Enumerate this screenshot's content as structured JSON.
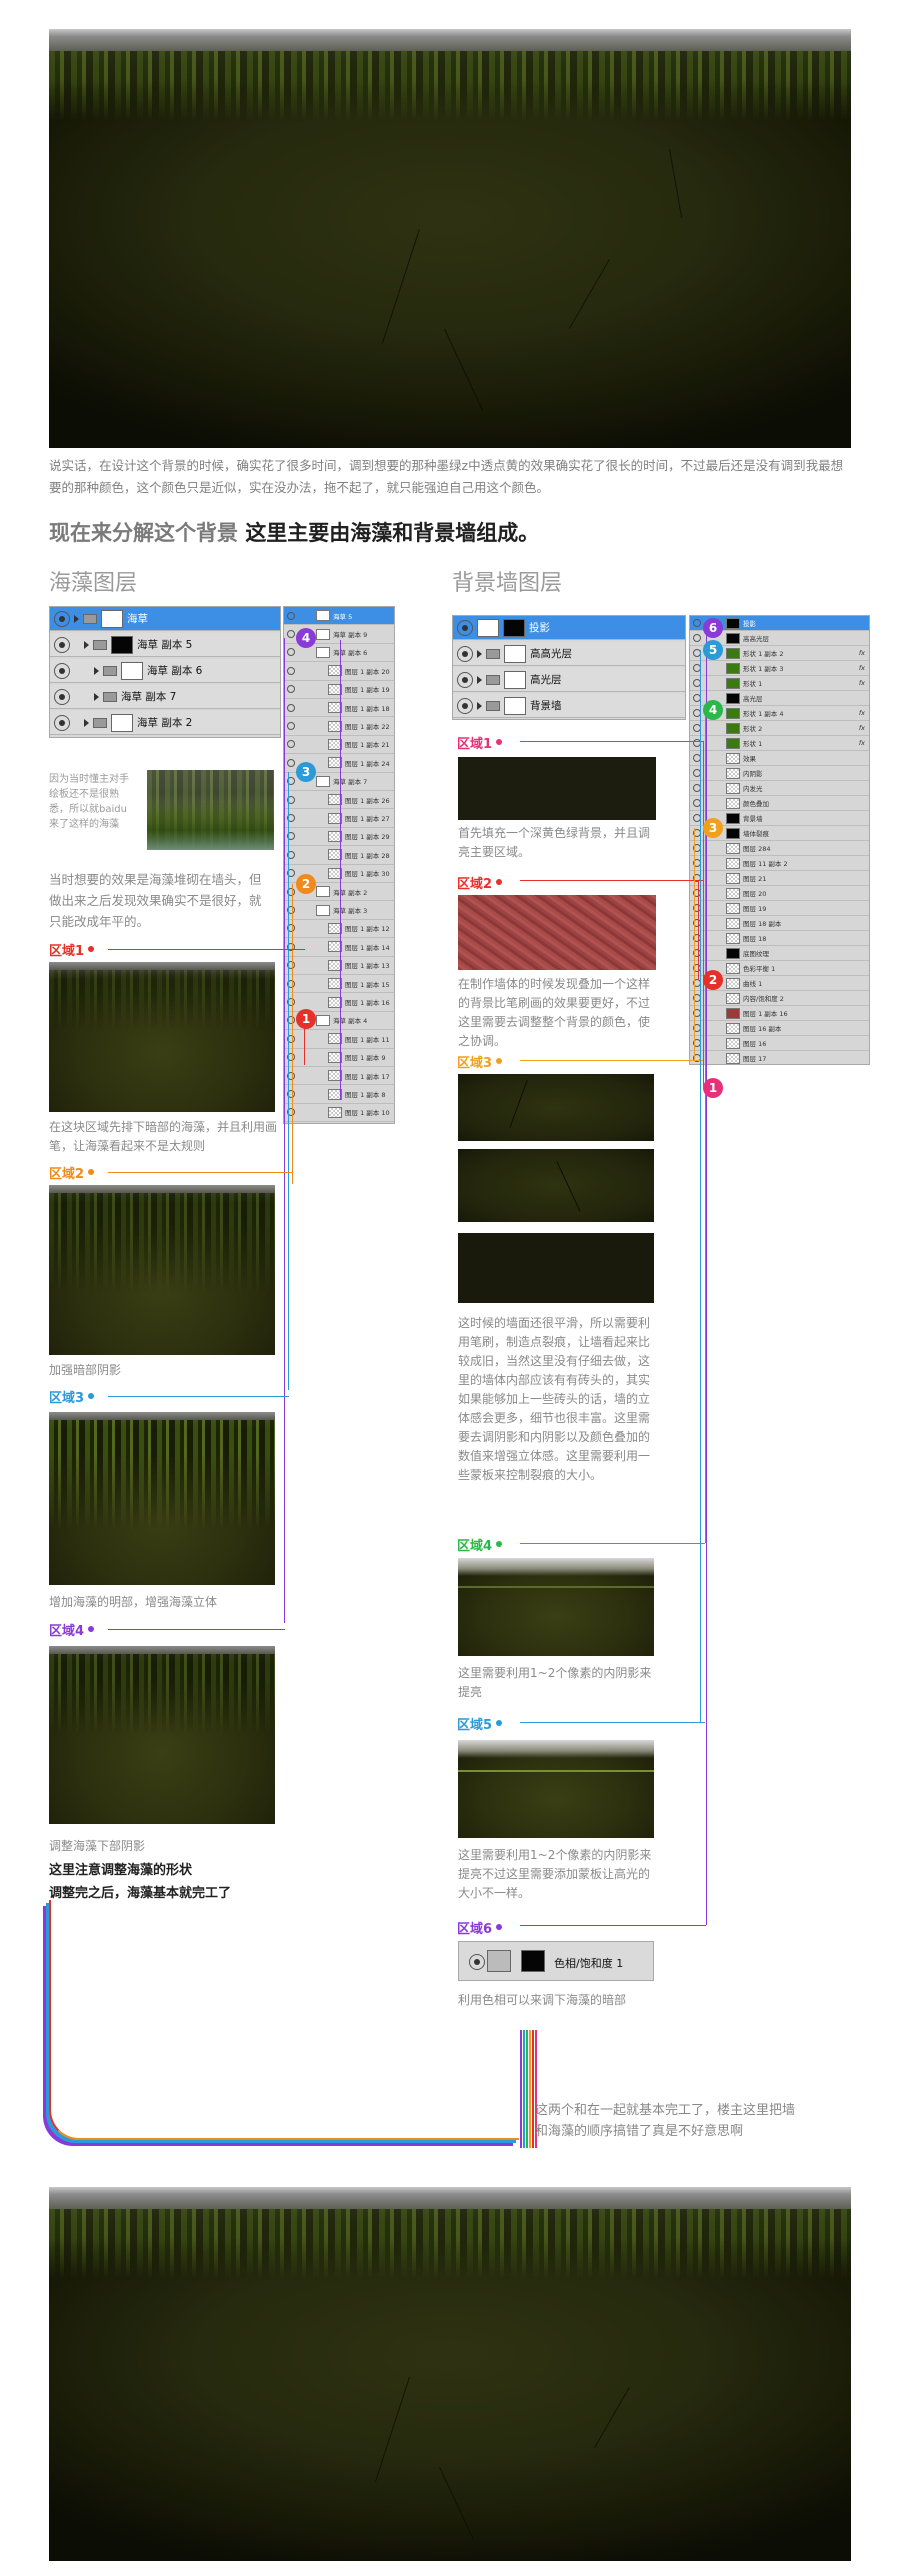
{
  "intro_text": "说实话，在设计这个背景的时候，确实花了很多时间，调到想要的那种墨绿z中透点黄的效果确实花了很长的时间，不过最后还是没有调到我最想要的那种颜色，这个颜色只是近似，实在没办法，拖不起了，就只能强迫自己用这个颜色。",
  "headline": {
    "lead": "现在来分解这个背景",
    "strong": "这里主要由海藻和背景墙组成。"
  },
  "left_column": {
    "title": "海藻图层",
    "layer_panel": {
      "rows": [
        {
          "label": "海草",
          "selected": true,
          "thumb": "white"
        },
        {
          "label": "海草 副本 5",
          "selected": false,
          "thumb": "black"
        },
        {
          "label": "海草 副本 6",
          "selected": false,
          "thumb": "white"
        },
        {
          "label": "海草 副本 7",
          "selected": false,
          "thumb": "none"
        },
        {
          "label": "海草 副本 2",
          "selected": false,
          "thumb": "white"
        }
      ]
    },
    "side_note": "因为当时懂主对手绘板还不是很熟悉，所以就baidu来了这样的海藻",
    "desc": "当时想要的效果是海藻堆砌在墙头，但做出来之后发现效果确实不是很好，就只能改成年平的。",
    "regions": [
      {
        "label": "区域1",
        "color": "#e8302a",
        "caption": "在这块区域先排下暗部的海藻，并且利用画笔，让海藻看起来不是太规则"
      },
      {
        "label": "区域2",
        "color": "#f08a1c",
        "caption": "加强暗部阴影"
      },
      {
        "label": "区域3",
        "color": "#2a9ad8",
        "caption": "增加海藻的明部，增强海藻立体"
      },
      {
        "label": "区域4",
        "color": "#8a3ad8",
        "caption": "调整海藻下部阴影"
      }
    ],
    "final_note_1": "这里注意调整海藻的形状",
    "final_note_2": "调整完之后，海藻基本就完工了"
  },
  "middle_panel": {
    "rows": [
      "海草 5",
      "海草 副本 9",
      "海草 副本 6",
      "图层 1 副本 20",
      "图层 1 副本 19",
      "图层 1 副本 18",
      "图层 1 副本 22",
      "图层 1 副本 21",
      "图层 1 副本 24",
      "海草 副本 7",
      "图层 1 副本 26",
      "图层 1 副本 27",
      "图层 1 副本 29",
      "图层 1 副本 28",
      "图层 1 副本 30",
      "海草 副本 2",
      "海草 副本 3",
      "图层 1 副本 12",
      "图层 1 副本 14",
      "图层 1 副本 13",
      "图层 1 副本 15",
      "图层 1 副本 16",
      "海草 副本 4",
      "图层 1 副本 11",
      "图层 1 副本 9",
      "图层 1 副本 17",
      "图层 1 副本 8",
      "图层 1 副本 10"
    ],
    "badges": [
      {
        "num": "4",
        "color": "#8a3ad8"
      },
      {
        "num": "3",
        "color": "#2a9ad8"
      },
      {
        "num": "2",
        "color": "#f08a1c"
      },
      {
        "num": "1",
        "color": "#e8302a"
      }
    ]
  },
  "right_column": {
    "title": "背景墙图层",
    "layer_panel": {
      "rows": [
        {
          "label": "投影",
          "selected": true
        },
        {
          "label": "高高光层",
          "selected": false
        },
        {
          "label": "高光层",
          "selected": false
        },
        {
          "label": "背景墙",
          "selected": false
        }
      ]
    },
    "regions": [
      {
        "label": "区域1",
        "color": "#e8307a",
        "caption": "首先填充一个深黄色绿背景，并且调亮主要区域。"
      },
      {
        "label": "区域2",
        "color": "#e8302a",
        "caption": "在制作墙体的时候发现叠加一个这样的背景比笔刷画的效果要更好，不过这里需要去调整整个背景的颜色，使之协调。"
      },
      {
        "label": "区域3",
        "color": "#f0a01c",
        "caption": "这时候的墙面还很平滑，所以需要利用笔刷，制造点裂痕，让墙看起来比较成旧，当然这里没有仔细去做，这里的墙体内部应该有有砖头的，其实如果能够加上一些砖头的话，墙的立体感会更多，细节也很丰富。这里需要去调阴影和内阴影以及颜色叠加的数值来增强立体感。这里需要利用一些蒙板来控制裂痕的大小。"
      },
      {
        "label": "区域4",
        "color": "#2ab84a",
        "caption": "这里需要利用1~2个像素的内阴影来提亮"
      },
      {
        "label": "区域5",
        "color": "#2a9ad8",
        "caption": "这里需要利用1~2个像素的内阴影来提亮不过这里需要添加蒙板让高光的大小不一样。"
      },
      {
        "label": "区域6",
        "color": "#8a3ad8",
        "caption": "利用色相可以来调下海藻的暗部"
      }
    ],
    "hue_layer_label": "色相/饱和度 1"
  },
  "right_panel": {
    "rows": [
      "投影",
      "高高光层",
      "形状 1 副本 2",
      "形状 1 副本 3",
      "形状 1",
      "高光层",
      "形状 1 副本 4",
      "形状 2",
      "形状 1",
      "效果",
      "内阴影",
      "内发光",
      "颜色叠加",
      "背景墙",
      "墙体裂痕",
      "图层 284",
      "图层 11 副本 2",
      "图层 21",
      "图层 20",
      "图层 19",
      "图层 18 副本",
      "图层 18",
      "底图纹理",
      "色彩平衡 1",
      "曲线 1",
      "内容/饱和度 2",
      "图层 1 副本 16",
      "图层 16 副本",
      "图层 16",
      "图层 17"
    ],
    "badges": [
      {
        "num": "6",
        "color": "#8a3ad8"
      },
      {
        "num": "5",
        "color": "#2a9ad8"
      },
      {
        "num": "4",
        "color": "#2ab84a"
      },
      {
        "num": "3",
        "color": "#f0a01c"
      },
      {
        "num": "2",
        "color": "#e8302a"
      },
      {
        "num": "1",
        "color": "#e8307a"
      }
    ]
  },
  "merge_note": "这两个和在一起就基本完工了，楼主这里把墙和海藻的顺序搞错了真是不好意思啊"
}
